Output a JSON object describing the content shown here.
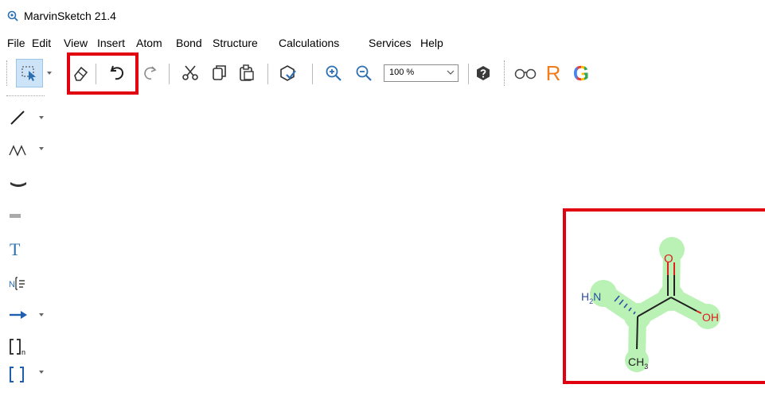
{
  "window": {
    "title": "MarvinSketch 21.4"
  },
  "menu": [
    "File",
    "Edit",
    "View",
    "Insert",
    "Atom",
    "Bond",
    "Structure",
    "Calculations",
    "Services",
    "Help"
  ],
  "toolbar": {
    "zoom": "100 %",
    "r_label": "R",
    "g_label": "G"
  },
  "left_toolbar": {
    "text_tool": "T",
    "sgroup_sub": "n"
  },
  "molecule": {
    "labels": {
      "amine": "H2N",
      "oxygen": "O",
      "hydroxyl": "OH",
      "methyl": "CH3"
    },
    "highlight_color": "#b9f2b4"
  },
  "annotations": {
    "highlight_color": "#e0000f"
  }
}
